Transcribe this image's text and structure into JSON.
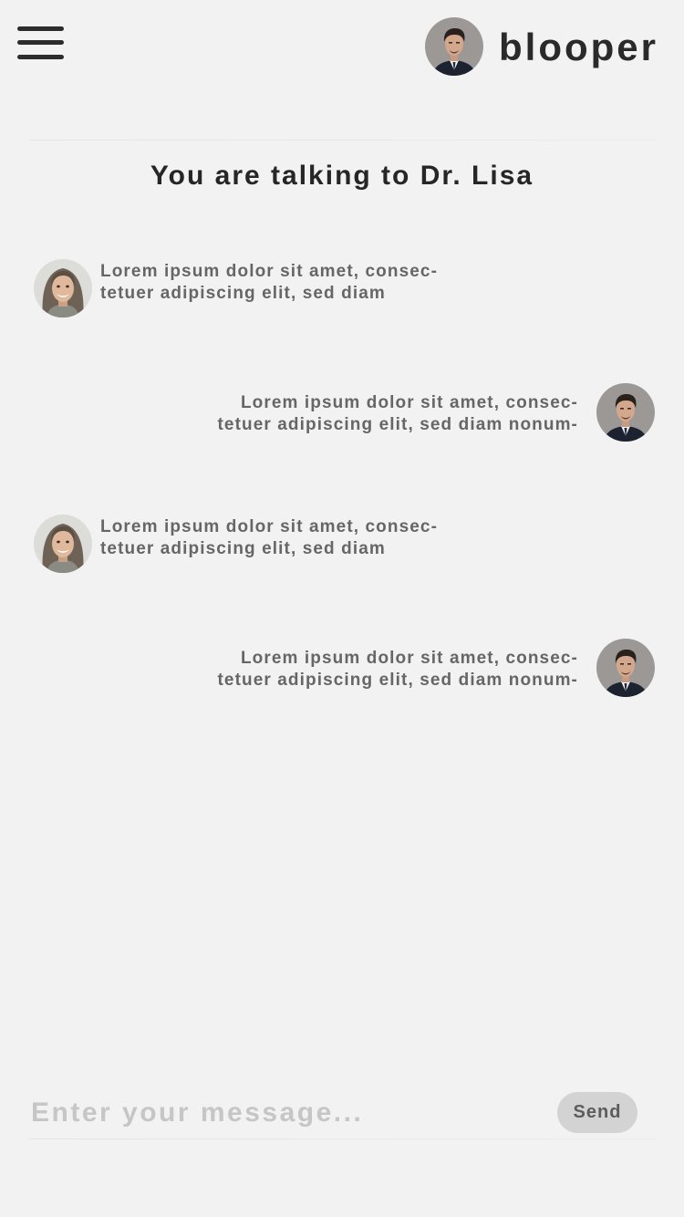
{
  "header": {
    "brand": "blooper",
    "menu_icon": "hamburger-menu-icon"
  },
  "chat": {
    "title": "You are talking to Dr. Lisa",
    "messages": [
      {
        "sender": "doctor",
        "lines": [
          "Lorem ipsum dolor sit amet, consec-",
          "tetuer adipiscing elit, sed diam"
        ]
      },
      {
        "sender": "user",
        "lines": [
          "Lorem ipsum dolor sit amet, consec-",
          "tetuer adipiscing elit, sed diam nonum-"
        ]
      },
      {
        "sender": "doctor",
        "lines": [
          "Lorem ipsum dolor sit amet, consec-",
          "tetuer adipiscing elit, sed diam"
        ]
      },
      {
        "sender": "user",
        "lines": [
          "Lorem ipsum dolor sit amet, consec-",
          "tetuer adipiscing elit, sed diam nonum-"
        ]
      }
    ]
  },
  "composer": {
    "placeholder": "Enter your message...",
    "value": "",
    "send_label": "Send"
  },
  "colors": {
    "background": "#f2f2f2",
    "text_dark": "#2a2a2a",
    "message_text": "#666666",
    "send_button_bg": "#d3d3d3",
    "placeholder": "#c6c6c6"
  }
}
